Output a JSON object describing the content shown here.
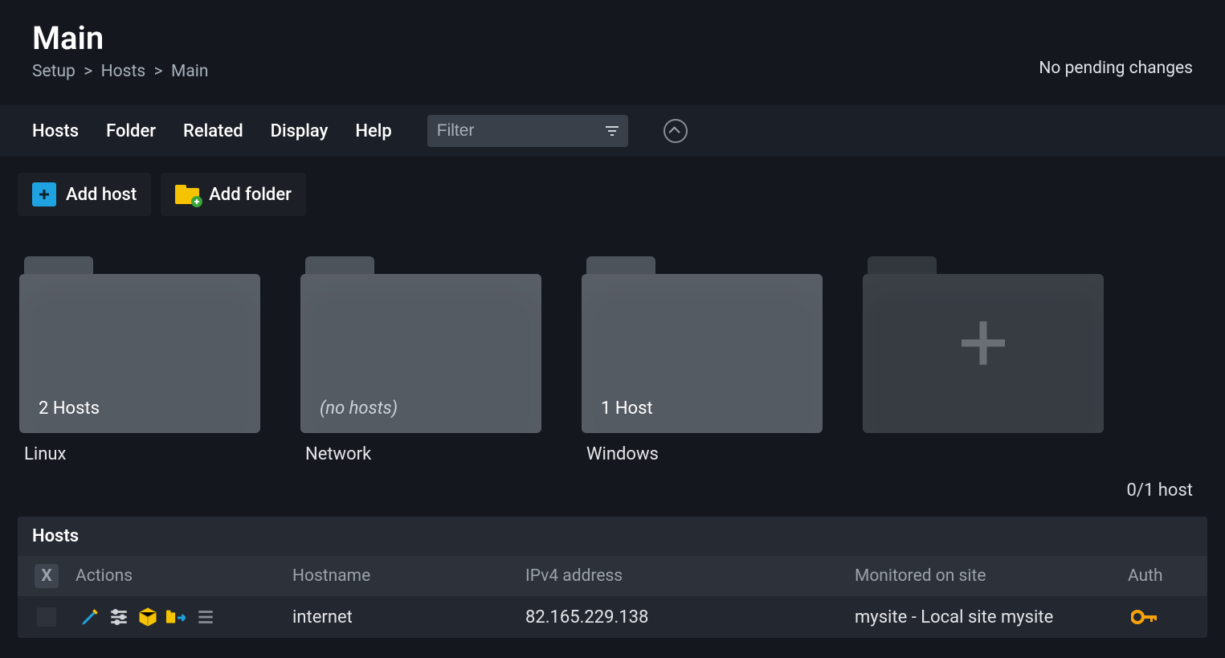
{
  "header": {
    "title": "Main",
    "breadcrumb": [
      "Setup",
      "Hosts",
      "Main"
    ],
    "pending": "No pending changes"
  },
  "menu": {
    "items": [
      "Hosts",
      "Folder",
      "Related",
      "Display",
      "Help"
    ],
    "filter_placeholder": "Filter"
  },
  "actions": {
    "add_host": "Add host",
    "add_folder": "Add folder"
  },
  "folders": [
    {
      "name": "Linux",
      "count_label": "2 Hosts",
      "empty": false
    },
    {
      "name": "Network",
      "count_label": "(no hosts)",
      "empty": true
    },
    {
      "name": "Windows",
      "count_label": "1 Host",
      "empty": false
    }
  ],
  "host_count": "0/1 host",
  "table": {
    "title": "Hosts",
    "columns": {
      "check": "X",
      "actions": "Actions",
      "hostname": "Hostname",
      "ipv4": "IPv4 address",
      "monitored": "Monitored on site",
      "auth": "Auth"
    },
    "rows": [
      {
        "hostname": "internet",
        "ipv4": "82.165.229.138",
        "monitored": "mysite - Local site mysite"
      }
    ]
  }
}
